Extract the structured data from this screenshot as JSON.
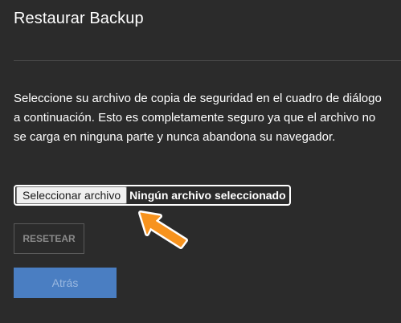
{
  "dialog": {
    "title": "Restaurar Backup",
    "description": "Seleccione su archivo de copia de seguridad en el cuadro de diálogo a continuación. Esto es completamente seguro ya que el archivo no se carga en ninguna parte y nunca abandona su navegador."
  },
  "file_input": {
    "button_label": "Seleccionar archivo",
    "status_text": "Ningún archivo seleccionado"
  },
  "buttons": {
    "reset_label": "RESETEAR",
    "back_label": "Atrás"
  },
  "annotation": {
    "arrow_icon": "pointer-arrow-icon",
    "arrow_color": "#f7931e"
  },
  "colors": {
    "background": "#2b2b2b",
    "primary_button": "#4a7ec2"
  }
}
